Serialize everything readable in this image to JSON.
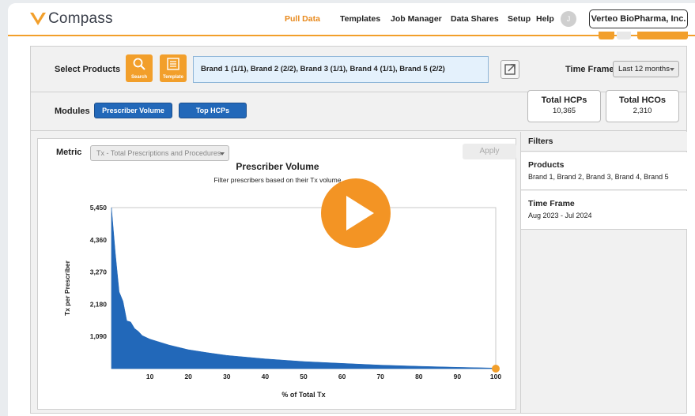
{
  "app": {
    "logo_text": "Compass",
    "brand_color": "#f29f2b"
  },
  "nav": {
    "items": [
      "Pull Data",
      "Templates",
      "Job Manager",
      "Data Shares",
      "Setup",
      "Help"
    ],
    "active": "Pull Data",
    "avatar_initial": "J",
    "company": "Verteo BioPharma, Inc."
  },
  "select_products": {
    "label": "Select Products",
    "search_label": "Search",
    "template_label": "Template",
    "selected": "Brand 1 (1/1), Brand 2 (2/2), Brand 3 (1/1), Brand 4 (1/1), Brand 5 (2/2)"
  },
  "time_frame": {
    "label": "Time Frame",
    "selected": "Last 12 months"
  },
  "modules": {
    "label": "Modules",
    "buttons": [
      "Prescriber Volume",
      "Top HCPs"
    ]
  },
  "stats": [
    {
      "title": "Total HCPs",
      "value": "10,365"
    },
    {
      "title": "Total HCOs",
      "value": "2,310"
    }
  ],
  "metric": {
    "label": "Metric",
    "selected": "Tx - Total Prescriptions and Procedures",
    "apply_label": "Apply"
  },
  "chart_data": {
    "type": "area",
    "title": "Prescriber Volume",
    "subtitle": "Filter prescribers based on their Tx volume",
    "xlabel": "% of Total Tx",
    "ylabel": "Tx per Prescriber",
    "x_ticks": [
      10,
      20,
      30,
      40,
      50,
      60,
      70,
      80,
      90,
      100
    ],
    "y_ticks": [
      1090,
      2180,
      3270,
      4360,
      5450
    ],
    "y_tick_labels": [
      "1,090",
      "2,180",
      "3,270",
      "4,360",
      "5,450"
    ],
    "xlim": [
      0,
      100
    ],
    "ylim": [
      0,
      5450
    ],
    "grid": false,
    "color": "#2268b9",
    "x": [
      0,
      1,
      2,
      3,
      4,
      5,
      6,
      7,
      8,
      10,
      12,
      15,
      20,
      25,
      30,
      40,
      50,
      60,
      70,
      80,
      90,
      100
    ],
    "y": [
      5450,
      3900,
      2600,
      2280,
      1620,
      1580,
      1360,
      1260,
      1120,
      1000,
      920,
      800,
      640,
      540,
      450,
      330,
      240,
      180,
      120,
      80,
      45,
      20
    ],
    "handle_x": 100
  },
  "filters": {
    "title": "Filters",
    "products_label": "Products",
    "products_value": "Brand 1, Brand 2, Brand 3, Brand 4, Brand 5",
    "time_label": "Time Frame",
    "time_value": "Aug 2023 - Jul 2024"
  }
}
